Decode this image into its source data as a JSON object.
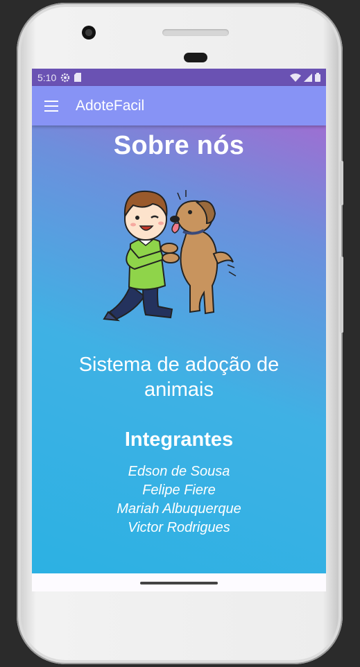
{
  "status_bar": {
    "time": "5:10",
    "left_icons": [
      "settings-icon",
      "sd-card-icon"
    ],
    "right_icons": [
      "wifi-icon",
      "signal-icon",
      "battery-icon"
    ]
  },
  "app_bar": {
    "menu_icon": "hamburger-menu-icon",
    "title": "AdoteFacil"
  },
  "page": {
    "title": "Sobre nós",
    "illustration": "boy-with-dog-illustration",
    "subtitle": "Sistema de adoção de animais",
    "members_heading": "Integrantes",
    "members": [
      "Edson de Sousa",
      "Felipe Fiere",
      "Mariah Albuquerque",
      "Victor Rodrigues"
    ]
  },
  "colors": {
    "status_bar": "#6a52b3",
    "app_bar": "#8793f5",
    "gradient_top": "#9d6fd2",
    "gradient_bottom": "#2cb1e3"
  }
}
